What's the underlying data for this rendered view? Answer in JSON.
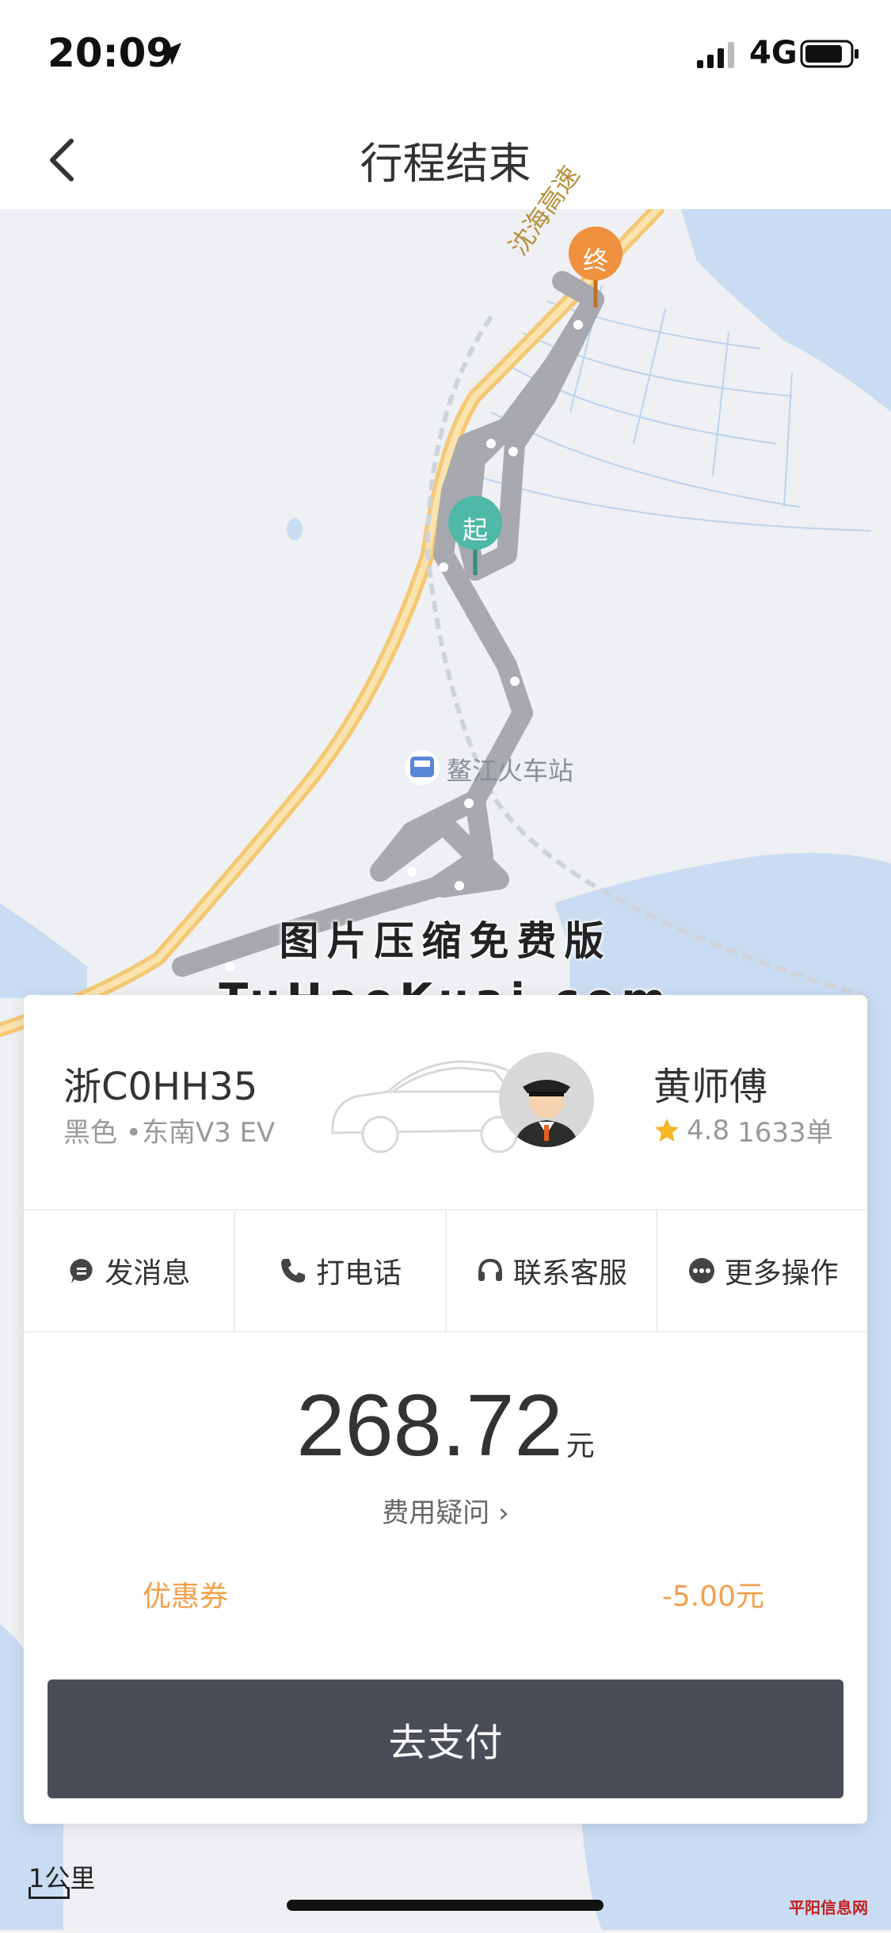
{
  "status_bar": {
    "time": "20:09",
    "network": "4G"
  },
  "nav": {
    "title": "行程结束"
  },
  "map": {
    "road_label": "沈海高速",
    "station_label": "鳌江火车站",
    "start_marker": "起",
    "end_marker": "终",
    "scale_label": "1公里"
  },
  "watermark": {
    "line1": "图片压缩免费版",
    "line2": "TuHaoKuai.com"
  },
  "trip_card": {
    "plate": "浙C0HH35",
    "car_info": "黑色 •东南V3 EV",
    "driver_name": "黄师傅",
    "rating": "4.8",
    "orders": "1633单",
    "actions": [
      {
        "label": "发消息",
        "icon": "message-icon"
      },
      {
        "label": "打电话",
        "icon": "phone-icon"
      },
      {
        "label": "联系客服",
        "icon": "headset-icon"
      },
      {
        "label": "更多操作",
        "icon": "more-icon"
      }
    ],
    "price": "268.72",
    "price_unit": "元",
    "fee_question": "费用疑问 ›",
    "coupon_label": "优惠券",
    "coupon_value": "-5.00元",
    "pay_button": "去支付"
  },
  "footer": {
    "site_logo": "平阳信息网"
  },
  "colors": {
    "accent": "#f2a04b",
    "start": "#4fb8a6",
    "end": "#f0913f",
    "pay_button": "#4a4c58"
  }
}
